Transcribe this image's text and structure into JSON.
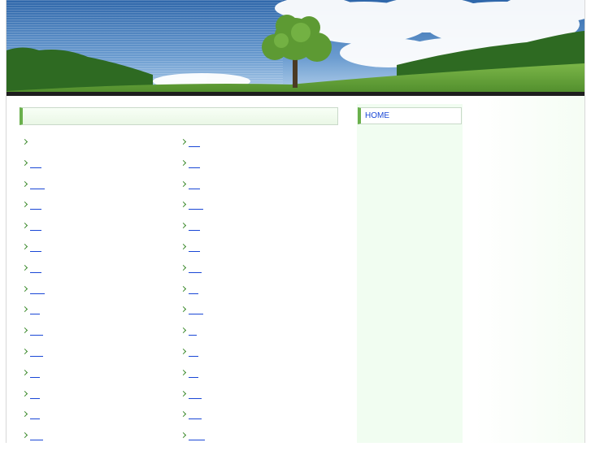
{
  "banner": {
    "sky_color": "#3f78b8",
    "grass_color": "#5c9a35",
    "forest_color": "#2e6a22"
  },
  "main": {
    "heading": "",
    "left_links": [
      {
        "label": "",
        "underline_width": 0
      },
      {
        "label": "",
        "underline_width": 14
      },
      {
        "label": "",
        "underline_width": 18
      },
      {
        "label": "",
        "underline_width": 14
      },
      {
        "label": "",
        "underline_width": 14
      },
      {
        "label": "",
        "underline_width": 14
      },
      {
        "label": "",
        "underline_width": 14
      },
      {
        "label": "",
        "underline_width": 18
      },
      {
        "label": "",
        "underline_width": 12
      },
      {
        "label": "",
        "underline_width": 16
      },
      {
        "label": "",
        "underline_width": 16
      },
      {
        "label": "",
        "underline_width": 12
      },
      {
        "label": "",
        "underline_width": 12
      },
      {
        "label": "",
        "underline_width": 12
      },
      {
        "label": "",
        "underline_width": 16
      }
    ],
    "right_links": [
      {
        "label": "",
        "underline_width": 14
      },
      {
        "label": "",
        "underline_width": 14
      },
      {
        "label": "",
        "underline_width": 14
      },
      {
        "label": "",
        "underline_width": 18
      },
      {
        "label": "",
        "underline_width": 14
      },
      {
        "label": "",
        "underline_width": 14
      },
      {
        "label": "",
        "underline_width": 16
      },
      {
        "label": "",
        "underline_width": 12
      },
      {
        "label": "",
        "underline_width": 18
      },
      {
        "label": "",
        "underline_width": 10
      },
      {
        "label": "",
        "underline_width": 12
      },
      {
        "label": "",
        "underline_width": 12
      },
      {
        "label": "",
        "underline_width": 16
      },
      {
        "label": "",
        "underline_width": 16
      },
      {
        "label": "",
        "underline_width": 20
      }
    ]
  },
  "sidebar": {
    "home_label": "HOME"
  },
  "colors": {
    "link": "#1a47d6",
    "accent": "#6ab04c",
    "sidebar_bg": "#f1fdf1"
  }
}
